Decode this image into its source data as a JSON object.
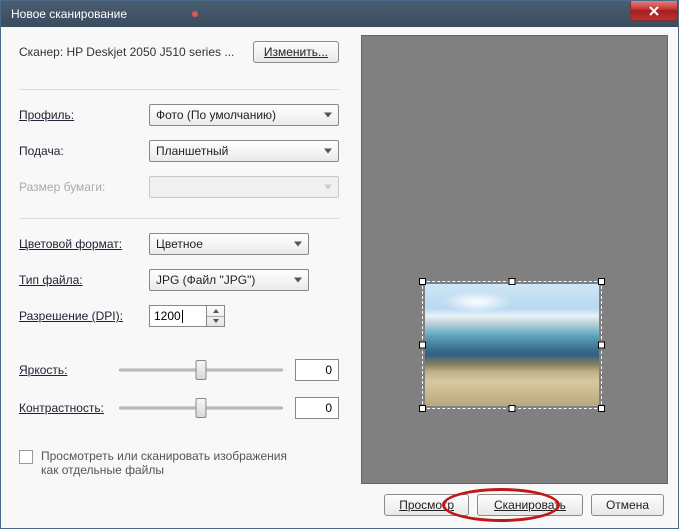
{
  "window": {
    "title": "Новое сканирование"
  },
  "scanner": {
    "label": "Сканер: HP Deskjet 2050 J510 series ...",
    "change_btn": "Изменить..."
  },
  "profile": {
    "label": "Профиль:",
    "value": "Фото (По умолчанию)"
  },
  "source": {
    "label": "Подача:",
    "value": "Планшетный"
  },
  "paper": {
    "label": "Размер бумаги:",
    "value": ""
  },
  "color": {
    "label": "Цветовой формат:",
    "value": "Цветное"
  },
  "filetype": {
    "label": "Тип файла:",
    "value": "JPG (Файл \"JPG\")"
  },
  "dpi": {
    "label": "Разрешение (DPI):",
    "value": "1200"
  },
  "brightness": {
    "label": "Яркость:",
    "value": "0"
  },
  "contrast": {
    "label": "Контрастность:",
    "value": "0"
  },
  "separate": {
    "label": "Просмотреть или сканировать изображения как отдельные файлы"
  },
  "buttons": {
    "preview": "Просмотр",
    "scan": "Сканировать",
    "cancel": "Отмена"
  }
}
